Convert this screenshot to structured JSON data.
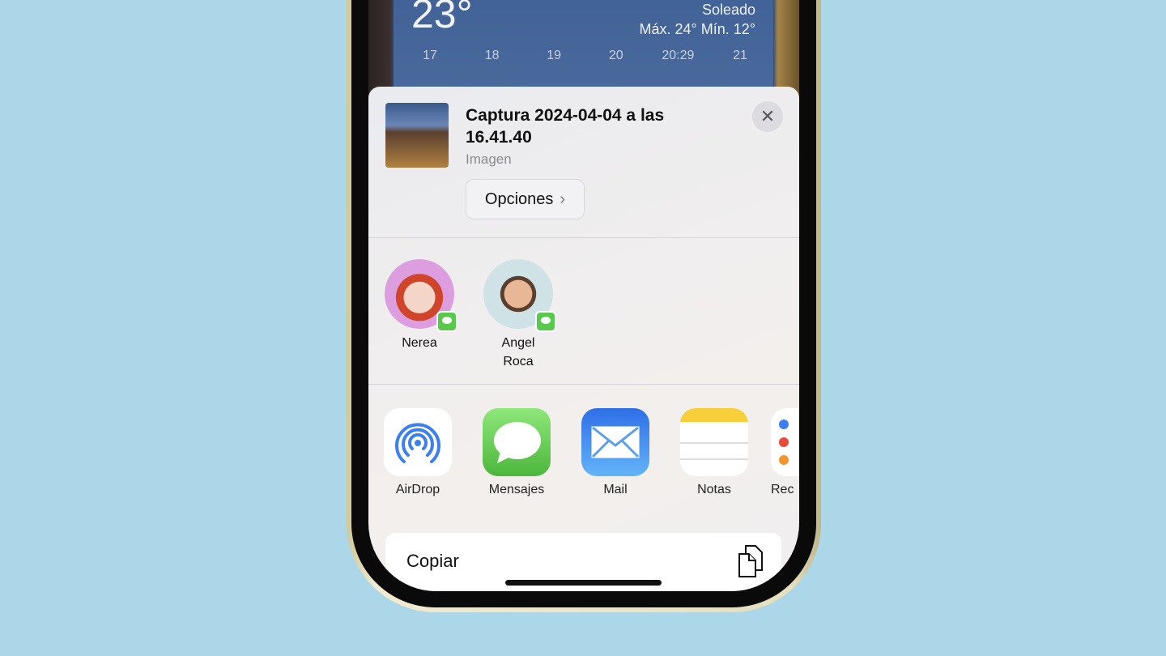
{
  "weather": {
    "temp": "23°",
    "condition": "Soleado",
    "range": "Máx. 24° Mín. 12°",
    "hours": [
      "17",
      "18",
      "19",
      "20",
      "20:29",
      "21"
    ]
  },
  "share": {
    "title": "Captura 2024-04-04 a las 16.41.40",
    "subtitle": "Imagen",
    "options_label": "Opciones",
    "close_icon": "close-icon"
  },
  "people": [
    {
      "name": "Nerea"
    },
    {
      "name": "Angel Roca"
    }
  ],
  "apps": [
    {
      "label": "AirDrop"
    },
    {
      "label": "Mensajes"
    },
    {
      "label": "Mail"
    },
    {
      "label": "Notas"
    },
    {
      "label": "Rec"
    }
  ],
  "actions": [
    {
      "label": "Copiar",
      "icon": "copy-icon"
    }
  ],
  "colors": {
    "background": "#acd7e8",
    "messages": "#58c94a",
    "mail": "#3b82f0",
    "notes": "#f7cf3b"
  }
}
